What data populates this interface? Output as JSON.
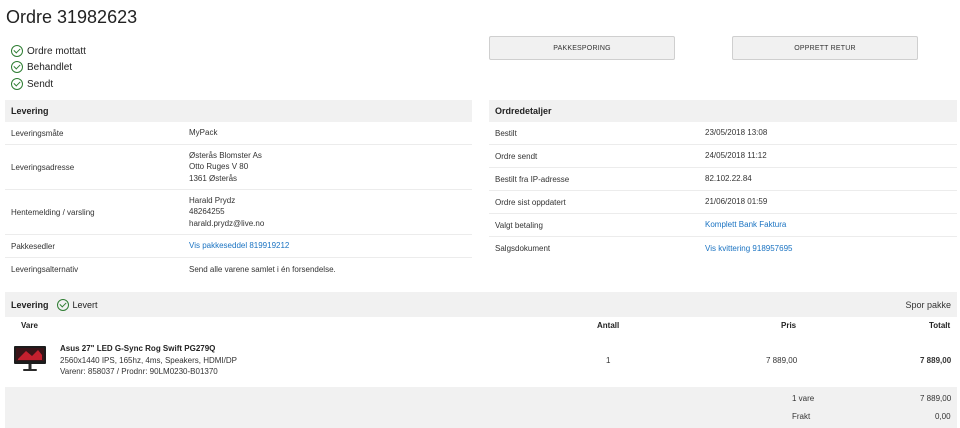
{
  "order": {
    "title": "Ordre 31982623"
  },
  "statuses": [
    "Ordre mottatt",
    "Behandlet",
    "Sendt"
  ],
  "buttons": {
    "tracking": "PAKKESPORING",
    "return": "OPPRETT RETUR"
  },
  "delivery": {
    "heading": "Levering",
    "method_label": "Leveringsmåte",
    "method_value": "MyPack",
    "address_label": "Leveringsadresse",
    "address_lines": [
      "Østerås Blomster As",
      "Otto Ruges V 80",
      "1361 Østerås"
    ],
    "pickup_label": "Hentemelding / varsling",
    "pickup_lines": [
      "Harald Prydz",
      "48264255",
      "harald.prydz@live.no"
    ],
    "slip_label": "Pakkesedler",
    "slip_value": "Vis pakkeseddel 819919212",
    "alt_label": "Leveringsalternativ",
    "alt_value": "Send alle varene samlet i én forsendelse."
  },
  "details": {
    "heading": "Ordredetaljer",
    "rows": [
      {
        "label": "Bestilt",
        "value": "23/05/2018 13:08"
      },
      {
        "label": "Ordre sendt",
        "value": "24/05/2018 11:12"
      },
      {
        "label": "Bestilt fra IP-adresse",
        "value": "82.102.22.84"
      },
      {
        "label": "Ordre sist oppdatert",
        "value": "21/06/2018 01:59"
      },
      {
        "label": "Valgt betaling",
        "value": "Komplett Bank Faktura"
      },
      {
        "label": "Salgsdokument",
        "value": "Vis kvittering 918957695"
      }
    ]
  },
  "shipment": {
    "label": "Levering",
    "status": "Levert",
    "track_link": "Spor pakke"
  },
  "table": {
    "headers": {
      "item": "Vare",
      "qty": "Antall",
      "price": "Pris",
      "total": "Totalt"
    }
  },
  "product": {
    "name": "Asus 27\" LED G-Sync Rog Swift PG279Q",
    "specs": "2560x1440 IPS, 165hz, 4ms, Speakers, HDMI/DP",
    "ids": "Varenr: 858037 / Prodnr: 90LM0230-B01370",
    "qty": "1",
    "price": "7 889,00",
    "total": "7 889,00"
  },
  "summary": {
    "items_label": "1 vare",
    "items_value": "7 889,00",
    "freight_label": "Frakt",
    "freight_value": "0,00"
  },
  "colors": {
    "accent": "#1a73c2",
    "success": "#2e7d32",
    "panel": "#f1f1f1"
  }
}
